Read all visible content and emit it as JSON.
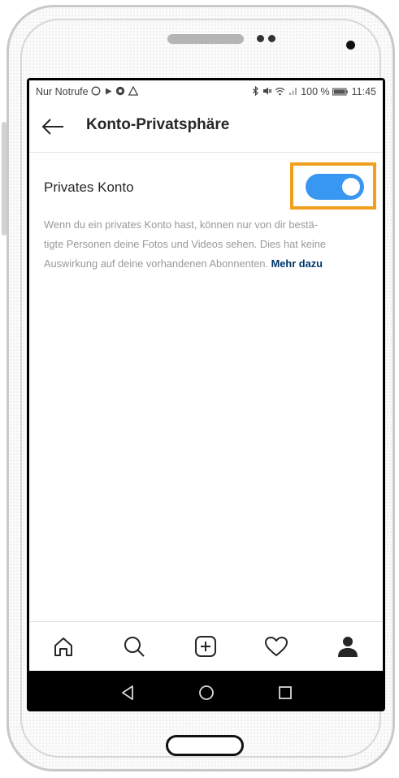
{
  "statusbar": {
    "left_text": "Nur Notrufe",
    "left_icons": [
      "whatsapp-icon",
      "play-icon",
      "vpn-icon",
      "warning-icon"
    ],
    "right_icons": [
      "bluetooth-icon",
      "mute-icon",
      "wifi-icon",
      "signal-icon"
    ],
    "battery": "100 %",
    "time": "11:45"
  },
  "header": {
    "title": "Konto-Privatsphäre",
    "back_icon": "arrow-left-icon"
  },
  "private_account": {
    "label": "Privates Konto",
    "enabled": true,
    "description": "Wenn du ein privates Konto hast, können nur von dir bestä-\ntigte Personen deine Fotos und Videos sehen. Dies hat keine\nAuswirkung auf deine vorhandenen Abonnenten.",
    "link": "Mehr dazu",
    "highlight_color": "#f0a01e",
    "toggle_color": "#3897f0"
  },
  "tabbar": {
    "items": [
      "home-icon",
      "search-icon",
      "add-icon",
      "heart-icon",
      "profile-icon"
    ]
  },
  "navbar": {
    "items": [
      "back-triangle-icon",
      "home-circle-icon",
      "recents-square-icon"
    ]
  }
}
